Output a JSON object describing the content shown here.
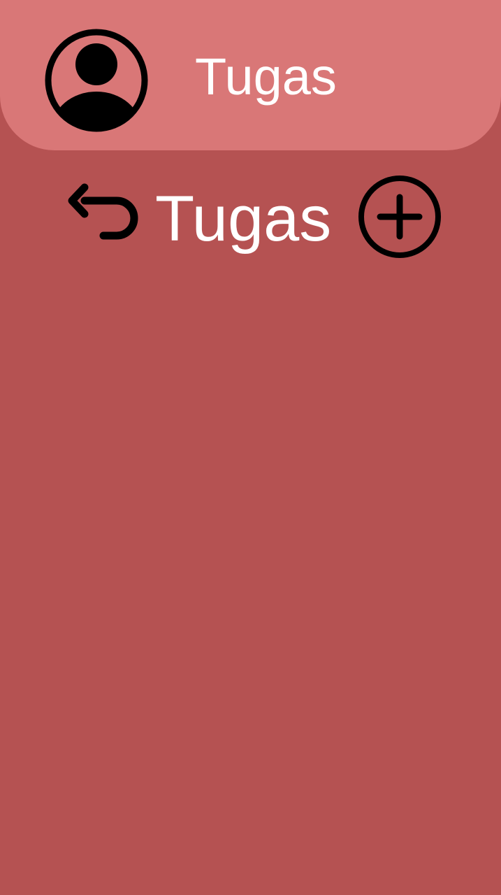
{
  "header": {
    "title": "Tugas",
    "avatar_icon": "account-circle-icon",
    "background_color": "#d97777"
  },
  "toolbar": {
    "back_icon": "undo-back-arrow-icon",
    "title": "Tugas",
    "add_icon": "add-circle-icon"
  },
  "colors": {
    "page_background": "#b55252",
    "text": "#ffffff",
    "icon": "#000000"
  },
  "tasks": []
}
